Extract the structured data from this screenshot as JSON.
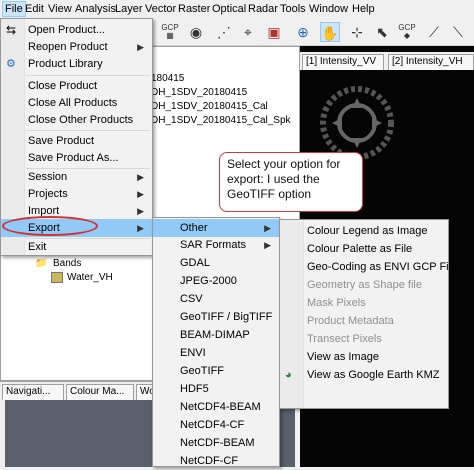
{
  "menubar": {
    "items": [
      "File",
      "Edit",
      "View",
      "Analysis",
      "Layer",
      "Vector",
      "Raster",
      "Optical",
      "Radar",
      "Tools",
      "Window",
      "Help"
    ]
  },
  "toolbar": {
    "gcp_label": "GCP"
  },
  "product_tree": {
    "items": [
      "180415",
      "DH_1SDV_20180415",
      "DH_1SDV_20180415_Cal",
      "DH_1SDV_20180415_Cal_Spk",
      "_1SDV_20180415_Cal_Spk"
    ],
    "bands_label": "Bands",
    "band_item": "Water_VH"
  },
  "image_tabs": [
    "[1] Intensity_VV",
    "[2] Intensity_VH"
  ],
  "bottom_tabs": [
    "Navigati...",
    "Colour Ma...",
    "Wo"
  ],
  "file_menu": {
    "items": [
      {
        "label": "Open Product...",
        "submenu": false
      },
      {
        "label": "Reopen Product",
        "submenu": true
      },
      {
        "label": "Product Library",
        "submenu": false
      },
      {
        "label": "Close Product",
        "submenu": false
      },
      {
        "label": "Close All Products",
        "submenu": false
      },
      {
        "label": "Close Other Products",
        "submenu": false
      },
      {
        "label": "Save Product",
        "submenu": false
      },
      {
        "label": "Save Product As...",
        "submenu": false
      },
      {
        "label": "Session",
        "submenu": true
      },
      {
        "label": "Projects",
        "submenu": true
      },
      {
        "label": "Import",
        "submenu": true
      },
      {
        "label": "Export",
        "submenu": true
      },
      {
        "label": "Exit",
        "submenu": false
      }
    ]
  },
  "export_menu": {
    "items": [
      "Other",
      "SAR Formats",
      "GDAL",
      "JPEG-2000",
      "CSV",
      "GeoTIFF / BigTIFF",
      "BEAM-DIMAP",
      "ENVI",
      "GeoTIFF",
      "HDF5",
      "NetCDF4-BEAM",
      "NetCDF4-CF",
      "NetCDF-BEAM",
      "NetCDF-CF"
    ]
  },
  "other_menu": {
    "items": [
      {
        "label": "Colour Legend as Image",
        "enabled": true
      },
      {
        "label": "Colour Palette as File",
        "enabled": true
      },
      {
        "label": "Geo-Coding as ENVI GCP File",
        "enabled": true
      },
      {
        "label": "Geometry as Shape file",
        "enabled": false
      },
      {
        "label": "Mask Pixels",
        "enabled": false
      },
      {
        "label": "Product Metadata",
        "enabled": false
      },
      {
        "label": "Transect Pixels",
        "enabled": false
      },
      {
        "label": "View as Image",
        "enabled": true
      },
      {
        "label": "View as Google Earth KMZ",
        "enabled": true
      }
    ]
  },
  "callout": {
    "text": "Select your option for export: I used the GeoTIFF option"
  },
  "colors": {
    "highlight": "#91c9f7",
    "callout_border": "#d03a3a",
    "image_bg": "#050505"
  }
}
